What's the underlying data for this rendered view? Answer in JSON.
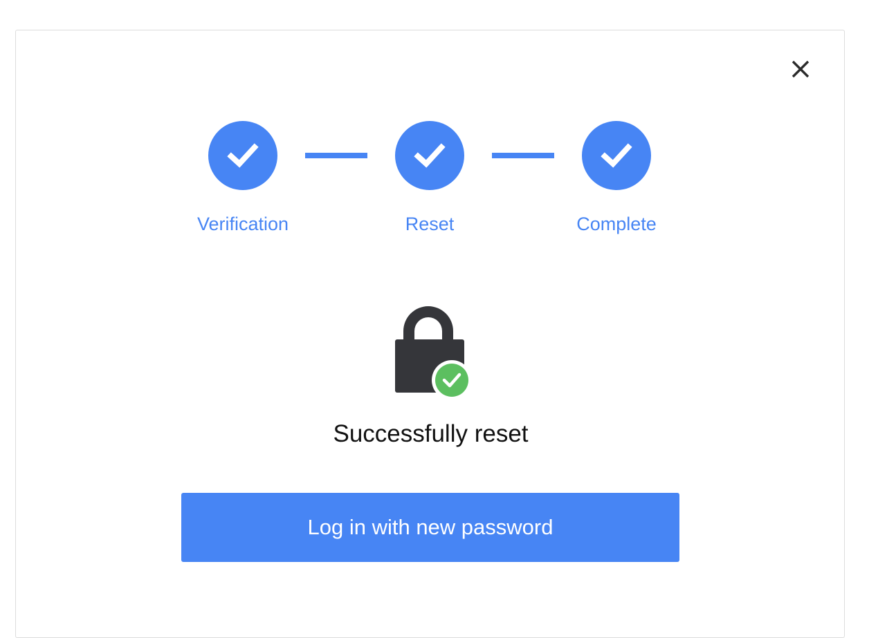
{
  "dialog": {
    "close_icon": "close-icon"
  },
  "stepper": {
    "steps": [
      {
        "label": "Verification",
        "status": "complete",
        "icon": "check-icon"
      },
      {
        "label": "Reset",
        "status": "complete",
        "icon": "check-icon"
      },
      {
        "label": "Complete",
        "status": "complete",
        "icon": "check-icon"
      }
    ]
  },
  "result": {
    "icon": "lock-success-icon",
    "message": "Successfully reset"
  },
  "actions": {
    "primary_label": "Log in with new password"
  },
  "colors": {
    "accent": "#4785f4",
    "success": "#5cbf60",
    "lock": "#35363a"
  }
}
